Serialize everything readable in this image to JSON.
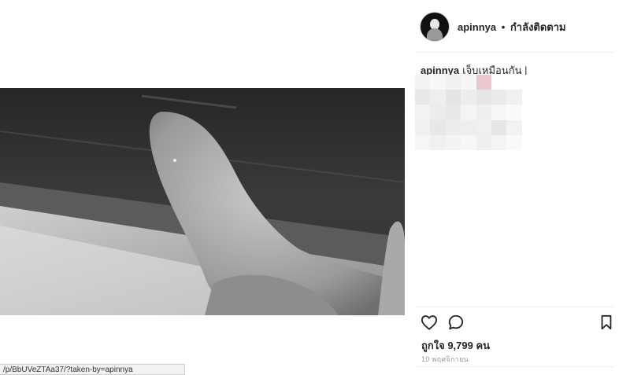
{
  "post": {
    "username": "apinnya",
    "follow_status": "กำลังติดตาม",
    "separator": "•",
    "caption_user": "apinnya",
    "caption_text": "เจ็บเหมือนกัน |",
    "likes_text": "ถูกใจ 9,799 คน",
    "date_text": "10 พฤศจิกายน"
  },
  "status_bar": {
    "url": "/p/BbUVeZTAa37/?taken-by=apinnya"
  },
  "icons": {
    "like": "heart-icon",
    "comment": "comment-icon",
    "save": "bookmark-icon"
  },
  "colors": {
    "text": "#262626",
    "muted": "#999999",
    "divider": "#efefef"
  }
}
